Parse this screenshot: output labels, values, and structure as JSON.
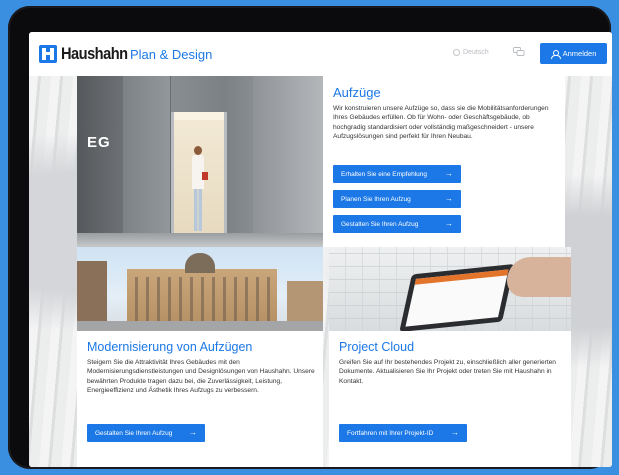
{
  "header": {
    "brand": "Haushahn",
    "section": "Plan & Design",
    "language": "Deutsch",
    "login_label": "Anmelden",
    "accent": "#1c78e6"
  },
  "cards": {
    "aufzuege": {
      "image_label": "EG",
      "title": "Aufzüge",
      "text": "Wir konstruieren unsere Aufzüge so, dass sie die Mobilitätsanforderungen Ihres Gebäudes erfüllen. Ob für Wohn- oder Geschäftsgebäude, ob hochgradig standardisiert oder vollständig maßgeschneidert - unsere Aufzugslösungen sind perfekt für Ihren Neubau.",
      "buttons": [
        "Erhalten Sie eine Empfehlung",
        "Planen Sie Ihren Aufzug",
        "Gestalten Sie Ihren Aufzug"
      ]
    },
    "modernisierung": {
      "title": "Modernisierung von Aufzügen",
      "text": "Steigern Sie die Attraktivität Ihres Gebäudes mit den Modernisierungsdienstleistungen und Designlösungen von Haushahn. Unsere bewährten Produkte tragen dazu bei, die Zuverlässigkeit, Leistung, Energieeffizienz und Ästhetik Ihres Aufzugs zu verbessern.",
      "button": "Gestalten Sie Ihren Aufzug"
    },
    "project_cloud": {
      "title": "Project Cloud",
      "text": "Greifen Sie auf Ihr bestehendes Projekt zu, einschließlich aller generierten Dokumente. Aktualisieren Sie Ihr Projekt oder treten Sie mit Haushahn in Kontakt.",
      "button": "Fortfahren mit Ihrer Projekt-ID"
    }
  },
  "icons": {
    "arrow": "→"
  }
}
